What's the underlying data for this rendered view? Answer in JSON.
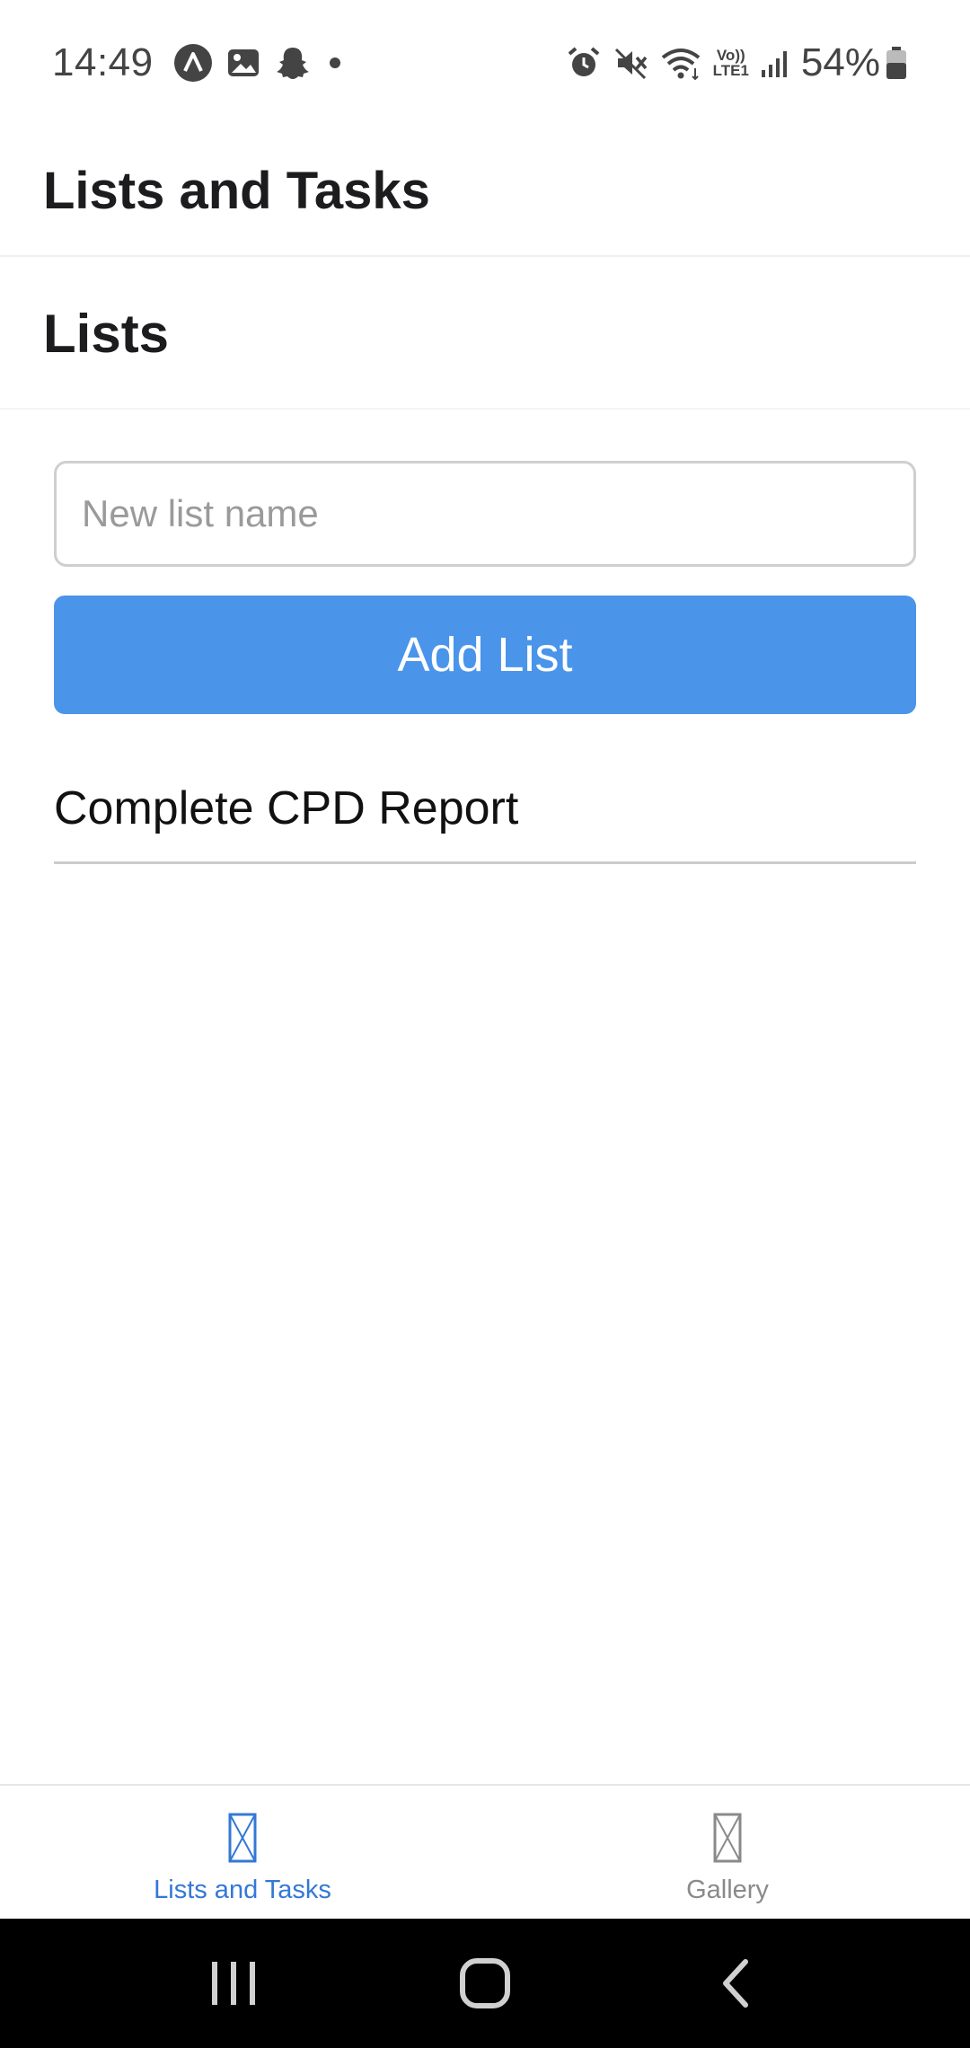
{
  "status_bar": {
    "time": "14:49",
    "left_icons": [
      "navigation-app-icon",
      "gallery-notification-icon",
      "snapchat-icon",
      "more-notifications-dot-icon"
    ],
    "right_icons": [
      "alarm-icon",
      "mute-icon",
      "wifi-icon",
      "volte-icon",
      "signal-icon"
    ],
    "volte_top": "Vo))",
    "volte_bottom": "LTE1",
    "battery": "54%"
  },
  "header": {
    "title": "Lists and Tasks"
  },
  "section": {
    "title": "Lists"
  },
  "form": {
    "input_value": "",
    "input_placeholder": "New list name",
    "add_button_label": "Add List"
  },
  "lists": [
    {
      "label": "Complete CPD Report"
    }
  ],
  "tab_bar": {
    "tabs": [
      {
        "label": "Lists and Tasks",
        "active": true,
        "icon": "missing-glyph-icon"
      },
      {
        "label": "Gallery",
        "active": false,
        "icon": "missing-glyph-icon"
      }
    ]
  },
  "nav_bar": {
    "buttons": [
      "recent-apps-icon",
      "home-icon",
      "back-icon"
    ]
  },
  "colors": {
    "accent": "#4a94ea",
    "active_tab": "#3478d6",
    "inactive_tab": "#8a8a8a"
  }
}
